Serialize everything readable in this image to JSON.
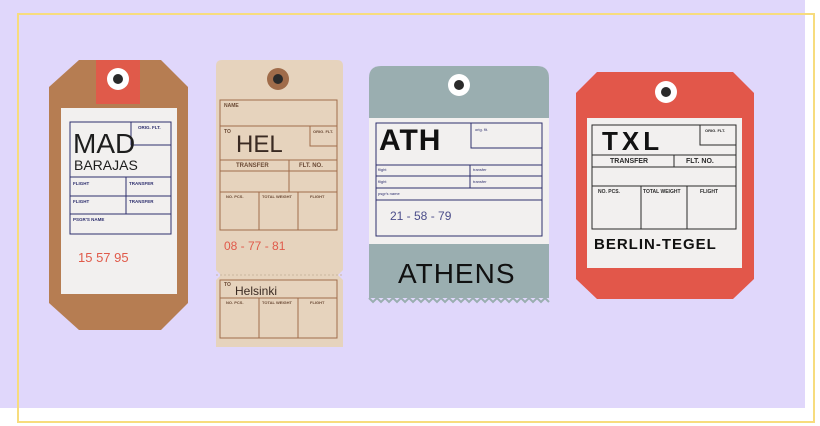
{
  "colors": {
    "background": "#e0d7fb",
    "frame": "#f7dc7e",
    "madrid_tag": "#b67d52",
    "madrid_accent": "#e05a4a",
    "helsinki_tag": "#e6d3bd",
    "helsinki_line": "#a06c4a",
    "athens_tag": "#9aaeb0",
    "berlin_tag": "#e2574a",
    "label_card": "#f2f0ef",
    "navy_line": "#2e2f6e",
    "red_number": "#e05a4a"
  },
  "tags": {
    "madrid": {
      "code": "MAD",
      "name": "BARAJAS",
      "orig_flt": "ORIG. FLT.",
      "flight_1": "FLIGHT",
      "transfer_1": "TRANSFER",
      "flight_2": "FLIGHT",
      "transfer_2": "TRANSFER",
      "pssgr_name": "PSGR'S NAME",
      "number": "15 57 95"
    },
    "helsinki": {
      "name_label": "NAME",
      "to_label": "TO",
      "code": "HEL",
      "orig_flt": "ORIG. FLT.",
      "transfer": "TRANSFER",
      "flt_no": "FLT. NO.",
      "no_pcs": "NO. PCS.",
      "total_weight": "TOTAL WEIGHT",
      "flight": "FLIGHT",
      "number": "08 - 77 - 81",
      "stub_to": "TO",
      "stub_city": "Helsinki",
      "stub_no_pcs": "NO. PCS.",
      "stub_total_weight": "TOTAL WEIGHT",
      "stub_flight": "FLIGHT"
    },
    "athens": {
      "code": "ATH",
      "orig_flt": "orig. flt.",
      "flight_1": "flight",
      "transfer_1": "transfer",
      "flight_2": "flight",
      "transfer_2": "transfer",
      "pssgr_name": "psgr's name",
      "number": "21 - 58 - 79",
      "city": "ATHENS"
    },
    "berlin": {
      "code": "TXL",
      "orig_flt": "ORIG. FLT.",
      "transfer": "TRANSFER",
      "flt_no": "FLT. NO.",
      "no_pcs": "NO. PCS.",
      "total_weight": "TOTAL WEIGHT",
      "flight": "FLIGHT",
      "city": "BERLIN-TEGEL"
    }
  }
}
